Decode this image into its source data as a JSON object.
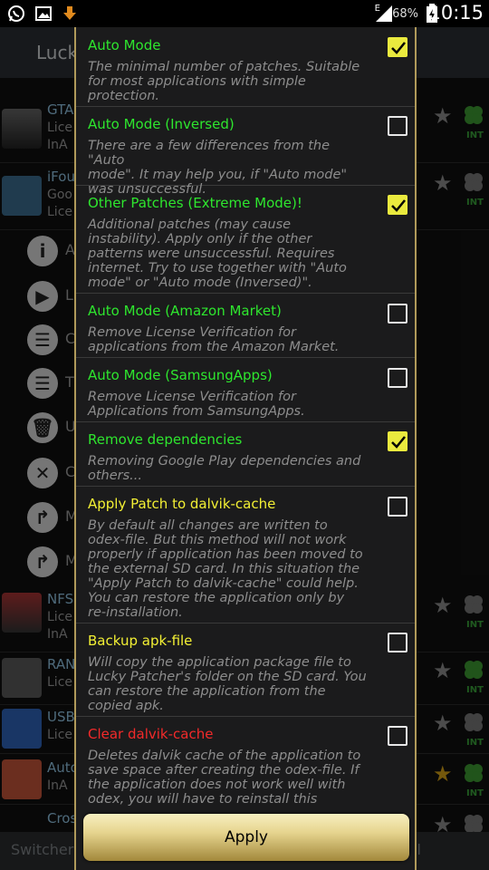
{
  "status_bar": {
    "battery_text": "68%",
    "network_label": "E",
    "time": "10:15",
    "icons": [
      "whatsapp-icon",
      "image-icon",
      "download-icon",
      "signal-icon",
      "battery-icon"
    ]
  },
  "background_app": {
    "title": "Luck",
    "rows": [
      {
        "name": "GTA",
        "sub1": "Lice",
        "sub2": "InA",
        "star": "grey",
        "clover": "green",
        "badge": "INT"
      },
      {
        "name": "iFou",
        "sub1": "Goo",
        "sub2": "Lice",
        "star": "grey",
        "clover": "grey",
        "badge": "INT"
      },
      {
        "name": "NFS",
        "sub1": "Lice",
        "sub2": "InA",
        "star": "grey",
        "clover": "grey",
        "badge": "INT"
      },
      {
        "name": "RAN",
        "sub1": "Lice",
        "sub2": "",
        "star": "grey",
        "clover": "green",
        "badge": "INT"
      },
      {
        "name": "USB",
        "sub1": "Lice",
        "sub2": "",
        "star": "grey",
        "clover": "grey",
        "badge": "INT"
      },
      {
        "name": "Auto",
        "sub1": "InA",
        "sub2": "",
        "star": "gold",
        "clover": "green",
        "badge": "INT"
      },
      {
        "name": "Cros",
        "sub1": "",
        "sub2": "",
        "star": "grey",
        "clover": "grey",
        "badge": ""
      }
    ],
    "actions": [
      {
        "icon": "info-icon",
        "label": "A"
      },
      {
        "icon": "play-icon",
        "label": "L"
      },
      {
        "icon": "list-icon",
        "label": "C"
      },
      {
        "icon": "list-icon",
        "label": "T"
      },
      {
        "icon": "trash-icon",
        "label": "U"
      },
      {
        "icon": "close-icon",
        "label": "C"
      },
      {
        "icon": "share-icon",
        "label": "M"
      },
      {
        "icon": "share-icon",
        "label": "M"
      }
    ],
    "bottom_left": "Switchers",
    "bottom_right": "ll"
  },
  "dialog": {
    "options": [
      {
        "title": "Auto Mode",
        "color": "green",
        "checked": true,
        "description": [
          "The minimal number of patches. Suitable",
          "for most applications with simple",
          "protection."
        ]
      },
      {
        "title": "Auto Mode (Inversed)",
        "color": "green",
        "checked": false,
        "description": [
          "There are a few differences from the \"Auto",
          "mode\". It may help you, if \"Auto mode\"",
          "was unsuccessful."
        ]
      },
      {
        "title": "Other Patches (Extreme Mode)!",
        "color": "green",
        "checked": true,
        "description": [
          "Additional patches (may cause",
          "instability). Apply only if the other",
          "patterns were unsuccessful. Requires",
          "internet. Try to use together with \"Auto",
          "mode\" or \"Auto mode (Inversed)\"."
        ]
      },
      {
        "title": "Auto Mode (Amazon Market)",
        "color": "green",
        "checked": false,
        "description": [
          "Remove License Verification for",
          "applications from the Amazon Market."
        ]
      },
      {
        "title": "Auto Mode (SamsungApps)",
        "color": "green",
        "checked": false,
        "description": [
          "Remove License Verification for",
          "Applications from SamsungApps."
        ]
      },
      {
        "title": "Remove dependencies",
        "color": "green",
        "checked": true,
        "description": [
          "Removing Google Play dependencies and",
          "others..."
        ]
      },
      {
        "title": "Apply Patch to dalvik-cache",
        "color": "yellow",
        "checked": false,
        "description": [
          "By default all changes are written to",
          "odex-file. But this method will not work",
          "properly if application has been moved to",
          "the external SD card. In this situation the",
          "\"Apply Patch to dalvik-cache\" could help.",
          "You can restore the application only by",
          "re-installation."
        ]
      },
      {
        "title": "Backup apk-file",
        "color": "yellow",
        "checked": false,
        "description": [
          "Will copy the application package file to",
          "Lucky Patcher's folder on the SD card. You",
          "can restore the application from the",
          "copied apk."
        ]
      },
      {
        "title": "Clear dalvik-cache",
        "color": "red",
        "checked": false,
        "description": [
          "Deletes dalvik cache of the application to",
          "save space after creating the odex-file. If",
          "the application does not work well with",
          "odex, you will have to reinstall this"
        ]
      }
    ],
    "apply_label": "Apply"
  },
  "colors": {
    "green": "#2ee62e",
    "yellow": "#f3f034",
    "red": "#f22a2a",
    "checkbox_on": "#eaea3e",
    "dialog_border": "#b09a5a"
  }
}
